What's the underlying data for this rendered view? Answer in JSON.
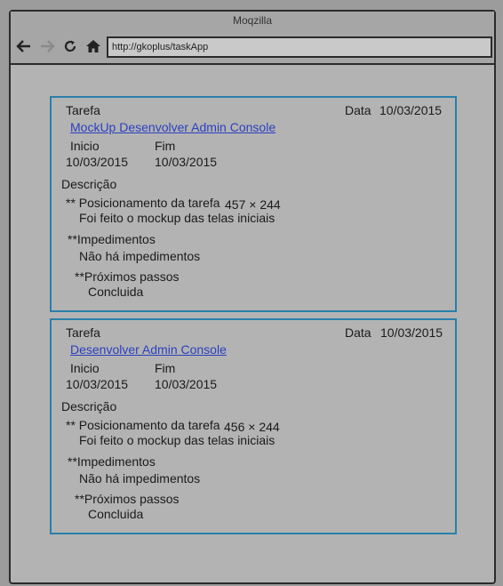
{
  "app": {
    "title": "Moqzilla"
  },
  "toolbar": {
    "back_icon": "back-arrow-icon",
    "forward_icon": "forward-arrow-icon",
    "reload_icon": "reload-icon",
    "home_icon": "home-icon",
    "url": "http://gkoplus/taskApp"
  },
  "tasks": [
    {
      "label_tarefa": "Tarefa",
      "label_data": "Data",
      "data": "10/03/2015",
      "title": "MockUp Desenvolver Admin Console",
      "label_inicio": "Inicio",
      "label_fim": "Fim",
      "inicio": "10/03/2015",
      "fim": "10/03/2015",
      "label_descricao": "Descrição",
      "posicionamento_label": "** Posicionamento da tarefa",
      "posicionamento_size": "457 × 244",
      "posicionamento_text": "Foi feito o mockup das telas iniciais",
      "impedimentos_label": "**Impedimentos",
      "impedimentos_text": "Não há impedimentos",
      "proximos_label": "**Próximos passos",
      "proximos_text": "Concluida"
    },
    {
      "label_tarefa": "Tarefa",
      "label_data": "Data",
      "data": "10/03/2015",
      "title": "Desenvolver Admin Console",
      "label_inicio": "Inicio",
      "label_fim": "Fim",
      "inicio": "10/03/2015",
      "fim": "10/03/2015",
      "label_descricao": "Descrição",
      "posicionamento_label": "** Posicionamento da tarefa",
      "posicionamento_size": "456 × 244",
      "posicionamento_text": "Foi feito o mockup das telas iniciais",
      "impedimentos_label": "**Impedimentos",
      "impedimentos_text": "Não há impedimentos",
      "proximos_label": "**Próximos passos",
      "proximos_text": "Concluida"
    }
  ],
  "colors": {
    "card_border": "#2a7fa8",
    "link": "#2b3fbf",
    "background": "#b3b3b3"
  }
}
